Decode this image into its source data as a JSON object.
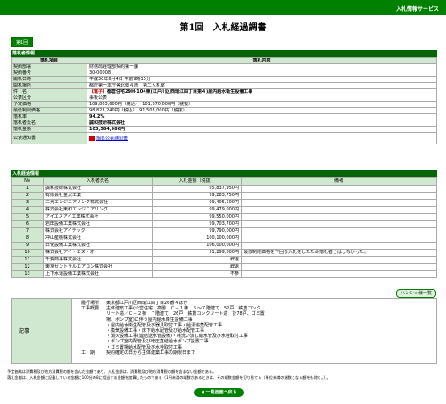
{
  "header": {
    "service": "入札情報サービス"
  },
  "title": "第1回　入札経過調書",
  "round_tab": "第1回",
  "info_section": {
    "heading": "落札者情報",
    "col_item": "落札項目",
    "col_content": "落札内容",
    "rows": [
      {
        "k": "契約部署",
        "v": "財務局経理部契約第一課"
      },
      {
        "k": "契約番号",
        "v": "30-00008"
      },
      {
        "k": "開札日時",
        "v": "平成30年6月4日 午前9時15分"
      },
      {
        "k": "開札場所",
        "v": "都庁第一本庁舎北側４階　第二入札室"
      }
    ],
    "kenmei_label": "件　名",
    "kenmei_tag": "【電子】",
    "kenmei_text": "都営住宅29H-104東(江戸川区西瑞江四丁目第４)屋内給水衛生設備工事",
    "rows2": [
      {
        "k": "公表区分",
        "v": "事後公表"
      },
      {
        "k": "予定価格",
        "v": "109,803,600円（税込）　101,670,000円（税抜）"
      },
      {
        "k": "最低制限価格",
        "v": "98,823,240円（税込）　91,503,000円（税抜）"
      },
      {
        "k": "落札率",
        "v": "94.2%"
      },
      {
        "k": "落札者氏名",
        "v": "誠和技研株式会社"
      },
      {
        "k": "落札金額",
        "v": "103,584,986円"
      }
    ],
    "notice_label": "公表通知書",
    "notice_link": "指名公表通知書"
  },
  "bid_section": {
    "heading": "入札経過情報",
    "headers": [
      "No",
      "入札者氏名",
      "入札金額（税抜）",
      "備考"
    ],
    "rows": [
      {
        "no": "1",
        "name": "誠和技研株式会社",
        "amount": "95,837,950円",
        "note": ""
      },
      {
        "no": "2",
        "name": "有限会社金沢工業",
        "amount": "99,283,750円",
        "note": ""
      },
      {
        "no": "3",
        "name": "三光エンジニアリング株式会社",
        "amount": "99,405,500円",
        "note": ""
      },
      {
        "no": "4",
        "name": "株式会社東和エンジニアリング",
        "amount": "99,479,000円",
        "note": ""
      },
      {
        "no": "5",
        "name": "アイエスアイ工業株式会社",
        "amount": "99,550,000円",
        "note": ""
      },
      {
        "no": "6",
        "name": "岩田設備工業株式会社",
        "amount": "99,703,700円",
        "note": ""
      },
      {
        "no": "7",
        "name": "株式会社アイテック",
        "amount": "99,790,000円",
        "note": ""
      },
      {
        "no": "8",
        "name": "冲山産機株式会社",
        "amount": "100,100,000円",
        "note": ""
      },
      {
        "no": "9",
        "name": "日化設備工業株式会社",
        "amount": "106,000,000円",
        "note": ""
      },
      {
        "no": "10",
        "name": "株式会社アイ・エヌ・オー",
        "amount": "91,299,800円",
        "note": "最低制限価格を下回る入札をしたため落札者とはしなかった。"
      },
      {
        "no": "11",
        "name": "千賀商事株式会社",
        "amount": "辞退",
        "note": ""
      },
      {
        "no": "12",
        "name": "東京セントラルエアコン株式会社",
        "amount": "辞退",
        "note": ""
      },
      {
        "no": "13",
        "name": "上下水道設備工業株式会社",
        "amount": "不参",
        "note": ""
      }
    ],
    "chart_button": "ハンシュ様一覧"
  },
  "kiji": {
    "label": "記事",
    "lines": [
      {
        "k": "履行場所",
        "v": "東京都江戸川区西瑞江四丁目26番４ほか"
      },
      {
        "k": "工事概要",
        "v": "主体建築工事(公営住宅　高層　Ｃ－１棟　５～７階建て　52戸　鉄筋コンク"
      },
      {
        "k": "",
        "v": "リート造／Ｃ－２棟　７階建て　26戸　鉄筋コンクリート造　計78戸、ゴミ置"
      },
      {
        "k": "",
        "v": "場、ポンプ室)に伴う屋内給水衛生設備工事"
      },
      {
        "k": "",
        "v": "・屋内給水衛生配管及び器具取付工事・給湯追焚配管工事"
      },
      {
        "k": "",
        "v": "・換気設備工事・床下給水配管及び給水配管工事"
      },
      {
        "k": "",
        "v": "・消火設備工事(連結送水管設備)・耗洗い流し給水管及び水栓取付工事"
      },
      {
        "k": "",
        "v": "・ポンプ室内配管及び増圧直結給水ポンプ設置工事"
      },
      {
        "k": "",
        "v": "・ゴミ置場給水配管及び水栓取付工事"
      },
      {
        "k": "工　期",
        "v": "契約確定の日から主体建築工事の期限日まで"
      }
    ]
  },
  "footnotes": [
    "予定価格は消費税及び地方消費税の額を含んだ金額であり、入札金額は、消費税及び地方消費税の額を含まない金額である。",
    "落札金額は、入札金額に記載している金額に100分の8に相当する金額を加算したものである（1円未満の端数があるときは、その端数金額を切り捨てる（単位未満の端数となる額をも除く。））。"
  ],
  "back_button": "◀ 一覧画面へ戻る"
}
